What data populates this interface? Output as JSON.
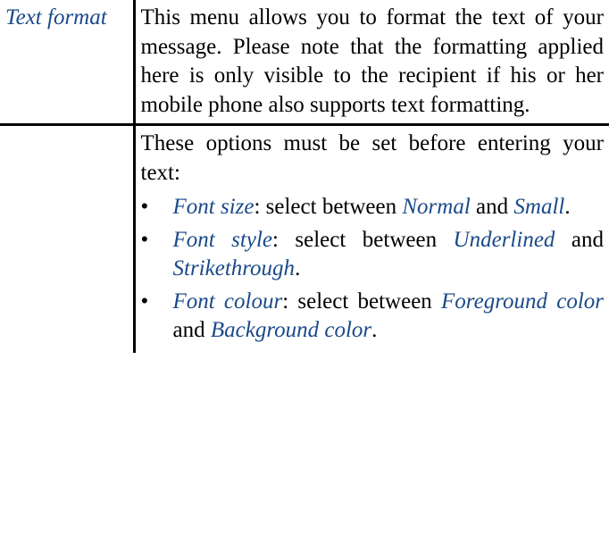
{
  "row1": {
    "left": "Text format",
    "right": "This menu allows you to format the text of your message. Please note that the formatting applied here is only visible to the recipient if his or her mobile phone also supports text formatting."
  },
  "row2": {
    "intro": "These options must be set before entering your text:",
    "items": [
      {
        "term": "Font size",
        "sep": ": select between ",
        "opt1": "Normal",
        "mid": " and ",
        "opt2": "Small",
        "end": "."
      },
      {
        "term": "Font style",
        "sep": ": select between ",
        "opt1": "Underlined",
        "mid": " and ",
        "opt2": "Strikethrough",
        "end": "."
      },
      {
        "term": "Font colour",
        "sep": ": select between ",
        "opt1": "Foreground color",
        "mid": " and ",
        "opt2": "Background color",
        "end": "."
      }
    ]
  }
}
